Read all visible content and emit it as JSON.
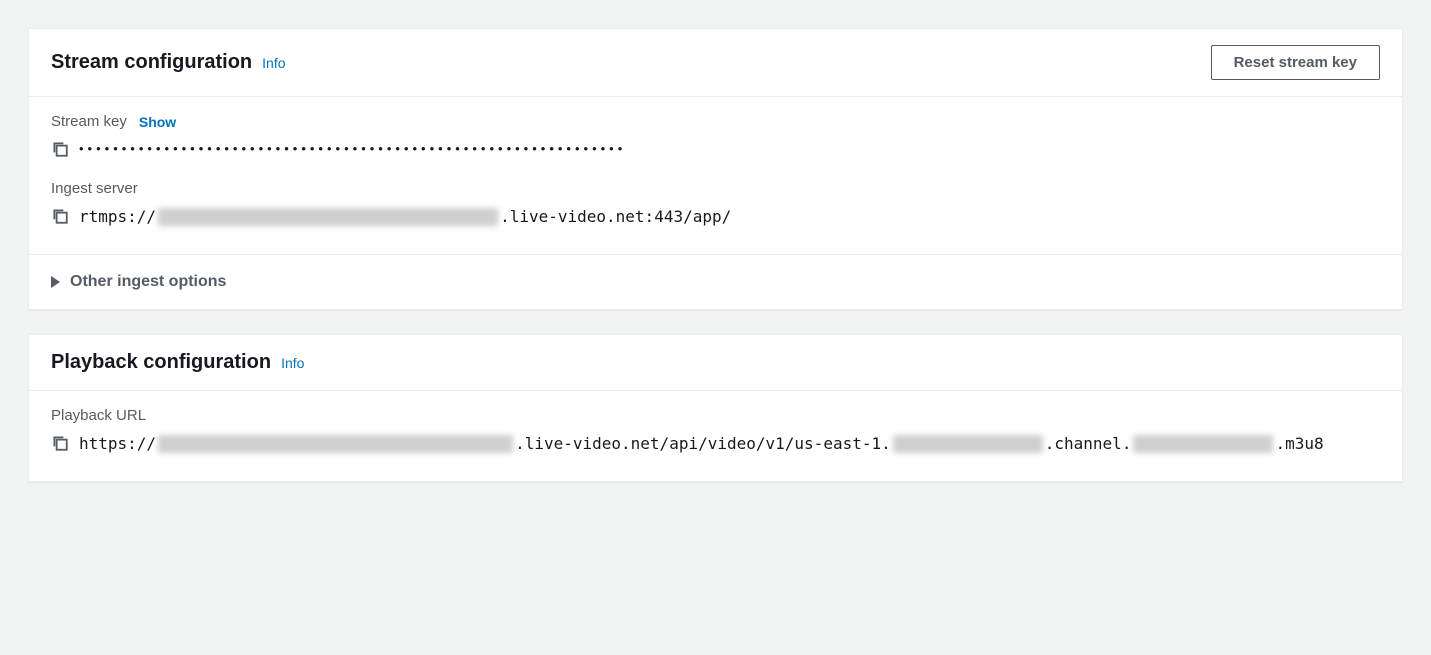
{
  "stream_panel": {
    "title": "Stream configuration",
    "info_label": "Info",
    "reset_button": "Reset stream key",
    "stream_key": {
      "label": "Stream key",
      "show_label": "Show",
      "masked_value": "••••••••••••••••••••••••••••••••••••••••••••••••••••••••••••••••"
    },
    "ingest_server": {
      "label": "Ingest server",
      "prefix": "rtmps://",
      "suffix": ".live-video.net:443/app/"
    },
    "other_ingest_label": "Other ingest options"
  },
  "playback_panel": {
    "title": "Playback configuration",
    "info_label": "Info",
    "playback_url": {
      "label": "Playback URL",
      "p1": "https://",
      "p2": ".live-video.net/api/video/v1/us-east-1.",
      "p3": ".channel.",
      "p4": ".m3u8"
    }
  }
}
